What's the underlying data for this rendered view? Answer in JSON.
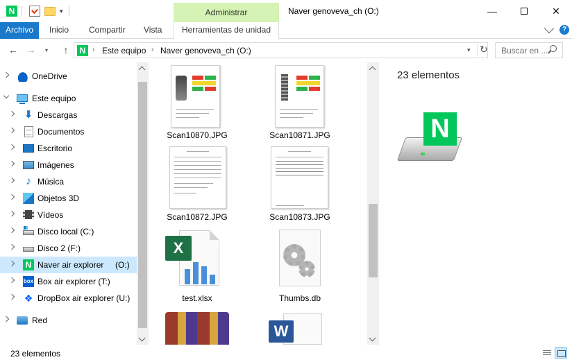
{
  "window": {
    "title": "Naver genoveva_ch (O:)",
    "context_tab_header": "Administrar",
    "quick_access_naver": "N",
    "dropdown_glyph": "▾",
    "minimize_glyph": "—",
    "close_glyph": "✕"
  },
  "ribbon": {
    "tabs": [
      "Archivo",
      "Inicio",
      "Compartir",
      "Vista",
      "Herramientas de unidad"
    ],
    "help_glyph": "?"
  },
  "address": {
    "icon_letter": "N",
    "separator": "›",
    "crumbs": [
      "Este equipo",
      "Naver genoveva_ch (O:)"
    ],
    "refresh_glyph": "↻",
    "back_glyph": "←",
    "forward_glyph": "→",
    "up_glyph": "↑",
    "history_glyph": "▾"
  },
  "search": {
    "placeholder": "Buscar en ..."
  },
  "nav": {
    "items": [
      {
        "label": "OneDrive"
      },
      {
        "label": "Este equipo"
      },
      {
        "label": "Descargas"
      },
      {
        "label": "Documentos"
      },
      {
        "label": "Escritorio"
      },
      {
        "label": "Imágenes"
      },
      {
        "label": "Música"
      },
      {
        "label": "Objetos 3D"
      },
      {
        "label": "Vídeos"
      },
      {
        "label": "Disco local (C:)"
      },
      {
        "label": "Disco 2 (F:)"
      },
      {
        "label": "Naver air explorer     (O:)"
      },
      {
        "label": "Box air explorer (T:)"
      },
      {
        "label": "DropBox air explorer (U:)"
      },
      {
        "label": "Red"
      }
    ],
    "icon_glyphs": {
      "download": "⬇",
      "music": "♪",
      "naver": "N",
      "box": "box",
      "dropbox": "❖"
    }
  },
  "files": [
    {
      "name": "Scan10870.JPG"
    },
    {
      "name": "Scan10871.JPG"
    },
    {
      "name": "Scan10872.JPG"
    },
    {
      "name": "Scan10873.JPG"
    },
    {
      "name": "test.xlsx"
    },
    {
      "name": "Thumbs.db"
    }
  ],
  "file_icon_letters": {
    "excel": "X",
    "word": "W",
    "drive": "N"
  },
  "details": {
    "count": "23 elementos"
  },
  "status": {
    "count": "23 elementos"
  },
  "colors": {
    "accent": "#1979ca",
    "context_tab": "#d4f3b4",
    "selection": "#cce8ff",
    "naver_green": "#03c75a"
  }
}
